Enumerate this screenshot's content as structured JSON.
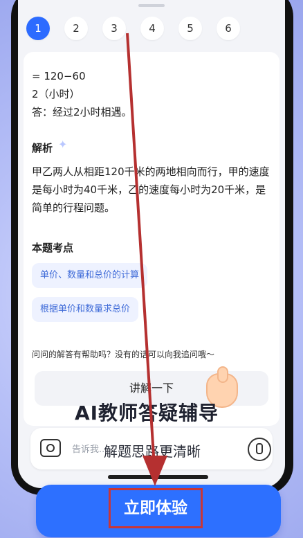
{
  "steps": [
    {
      "label": "1",
      "active": true
    },
    {
      "label": "2",
      "active": false
    },
    {
      "label": "3",
      "active": false
    },
    {
      "label": "4",
      "active": false
    },
    {
      "label": "5",
      "active": false
    },
    {
      "label": "6",
      "active": false
    }
  ],
  "solution": {
    "line1": "= 120−60",
    "line2": "2（小时）",
    "line3": "答：经过2小时相遇。"
  },
  "analysis": {
    "title": "解析",
    "text": "甲乙两人从相距120千米的两地相向而行，甲的速度是每小时为40千米，乙的速度每小时为20千米，是简单的行程问题。"
  },
  "key_points": {
    "title": "本题考点",
    "chips": [
      "单价、数量和总价的计算",
      "根据单价和数量求总价"
    ]
  },
  "helpful_prompt": "问问的解答有帮助吗？没有的话可以向我追问哦～",
  "explain_button": "讲解一下",
  "headline": "AI教师答疑辅导",
  "subline": "解题思路更清晰",
  "input": {
    "placeholder": "告诉我..."
  },
  "cta_label": "立即体验",
  "colors": {
    "accent": "#2d70ff",
    "arrow": "#b53030"
  },
  "icons": [
    "camera-icon",
    "microphone-icon",
    "sparkle-icon",
    "pointing-hand-icon",
    "arrow-annotation"
  ]
}
